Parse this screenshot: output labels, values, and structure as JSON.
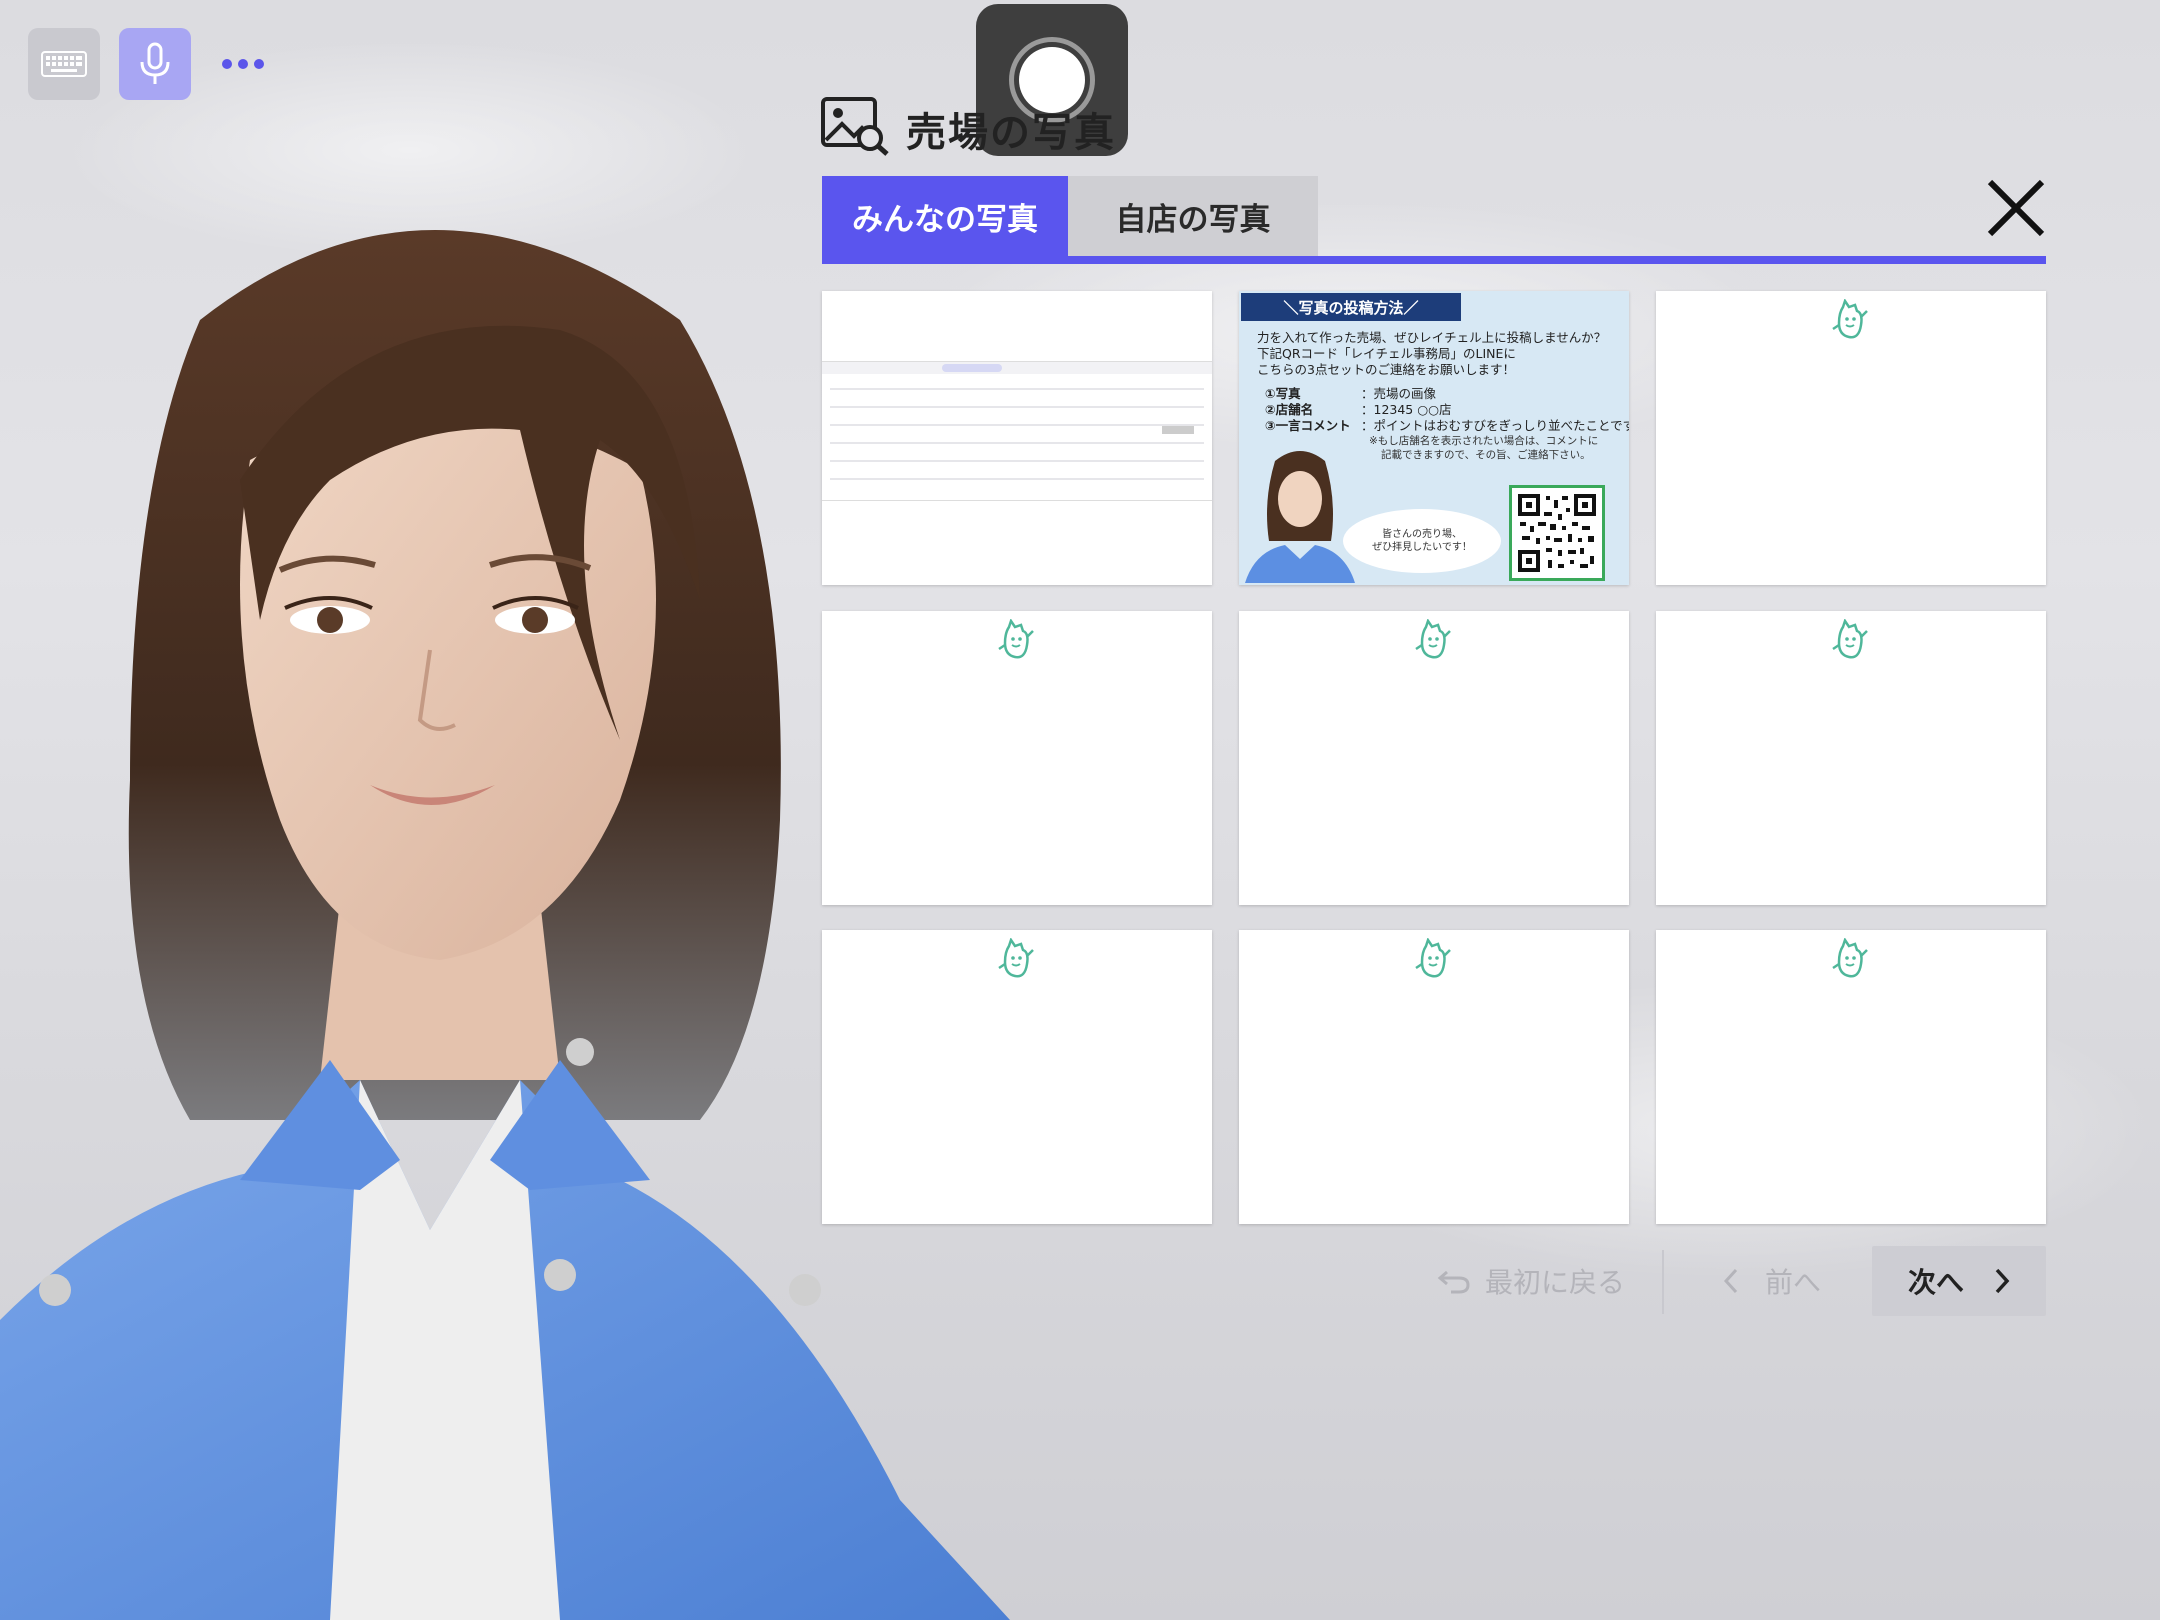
{
  "app": {
    "icons": {
      "keyboard": "keyboard-icon",
      "microphone": "microphone-icon",
      "more": "more-dots-icon",
      "record": "record-icon",
      "photo_search": "photo-search-icon",
      "close": "close-icon"
    },
    "accent_color": "#5a55ee"
  },
  "panel": {
    "title": "売場の写真",
    "tabs": [
      {
        "label": "みんなの写真",
        "selected": true
      },
      {
        "label": "自店の写真",
        "selected": false
      }
    ]
  },
  "gallery": {
    "cards": [
      {
        "type": "screenshot"
      },
      {
        "type": "poster",
        "heading": "＼写真の投稿方法／",
        "lines": [
          "力を入れて作った売場、ぜひレイチェル上に投稿しませんか？",
          "下記QRコード「レイチェル事務局」のLINEに",
          "こちらの3点セットのご連絡をお願いします！"
        ],
        "items": [
          {
            "key": "①写真",
            "value": "：売場の画像"
          },
          {
            "key": "②店舗名",
            "value": "：12345 ○○店"
          },
          {
            "key": "③一言コメント",
            "value": "：ポイントはおむすびをぎっしり並べたことです。"
          }
        ],
        "notes": [
          "※もし店舗名を表示されたい場合は、コメントに",
          "記載できますので、その旨、ご連絡下さい。"
        ],
        "bubble": [
          "皆さんの売り場、",
          "ぜひ拝見したいです！"
        ]
      },
      {
        "type": "placeholder"
      },
      {
        "type": "placeholder"
      },
      {
        "type": "placeholder"
      },
      {
        "type": "placeholder"
      },
      {
        "type": "placeholder"
      },
      {
        "type": "placeholder"
      },
      {
        "type": "placeholder"
      }
    ]
  },
  "pagination": {
    "first_label": "最初に戻る",
    "prev_label": "前へ",
    "next_label": "次へ"
  }
}
